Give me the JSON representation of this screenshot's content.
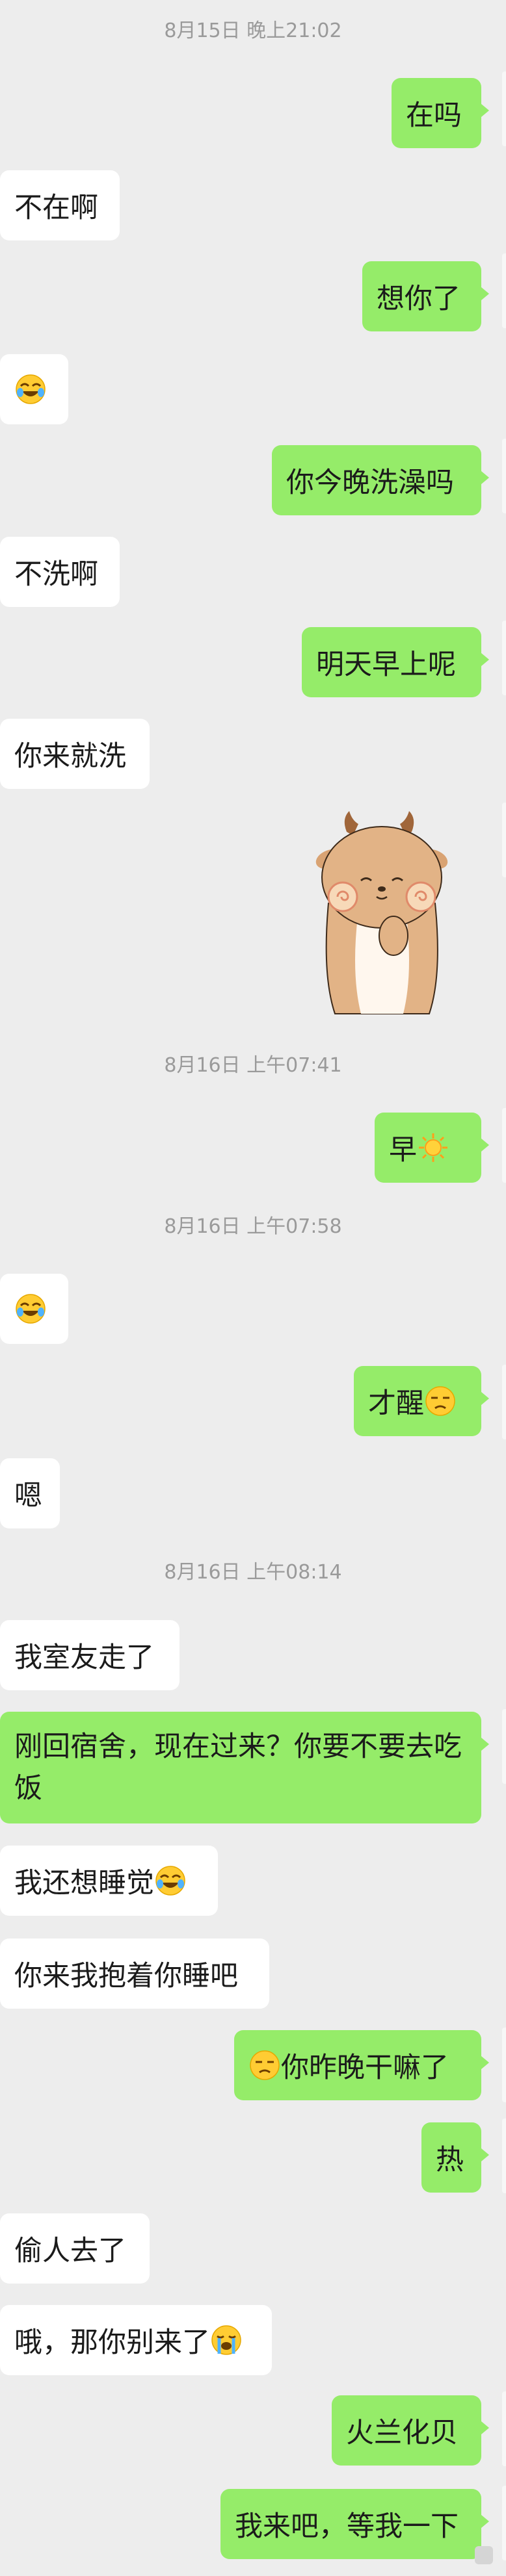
{
  "timestamps": {
    "t1": "8月15日 晚上21:02",
    "t2": "8月16日 上午07:41",
    "t3": "8月16日 上午07:58",
    "t4": "8月16日 上午08:14"
  },
  "messages": {
    "m1": "在吗",
    "m2": "不在啊",
    "m4": "想你了",
    "m6": "你今晚洗澡吗",
    "m7": "不洗啊",
    "m8": "明天早上呢",
    "m9": "你来就洗",
    "m11": "早",
    "m13": "才醒",
    "m14": "嗯",
    "m15": "我室友走了",
    "m16": "刚回宿舍，现在过来？你要不要去吃饭",
    "m17": "我还想睡觉",
    "m18": "你来我抱着你睡吧",
    "m19": "你昨晚干嘛了",
    "m20": "热",
    "m21": "偷人去了",
    "m22": "哦，那你别来了",
    "m23": "火兰化贝",
    "m24": "我来吧，等我一下"
  },
  "emojis": {
    "laugh_cry": "rolling-on-floor-laughing-emoji",
    "sun": "sun-emoji",
    "unamused": "unamused-face-emoji",
    "crying": "loudly-crying-emoji"
  },
  "sticker": {
    "name": "deer-sticker"
  },
  "colors": {
    "background": "#ededed",
    "incoming_bubble": "#ffffff",
    "outgoing_bubble": "#95ec69",
    "timestamp_text": "#9a9a9a"
  }
}
